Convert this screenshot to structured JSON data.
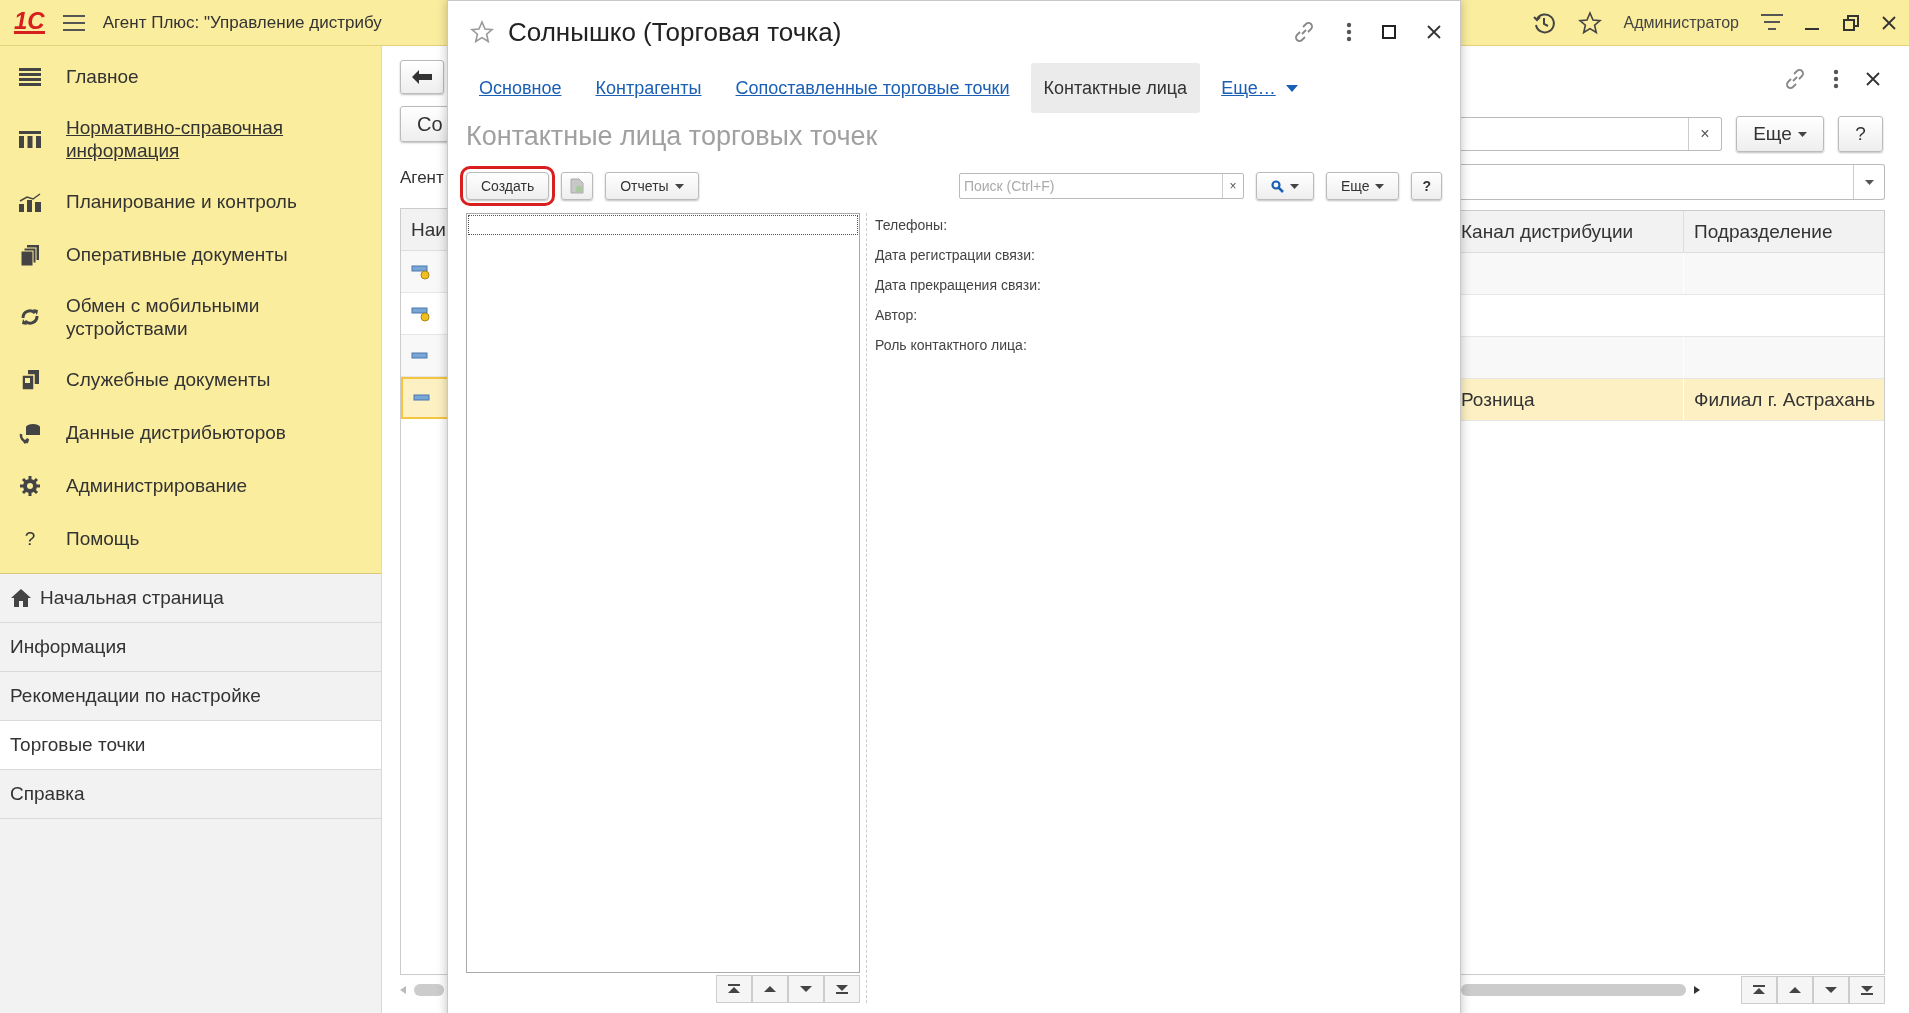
{
  "app_bar": {
    "logo": "1С",
    "title": "Агент Плюс: \"Управление дистрибу",
    "user": "Администратор"
  },
  "sidebar": {
    "sections": [
      {
        "label": "Главное",
        "underlined": false
      },
      {
        "label": "Нормативно-справочная информация",
        "underlined": true
      },
      {
        "label": "Планирование и контроль",
        "underlined": false
      },
      {
        "label": "Оперативные документы",
        "underlined": false
      },
      {
        "label": "Обмен с мобильными устройствами",
        "underlined": false
      },
      {
        "label": "Служебные документы",
        "underlined": false
      },
      {
        "label": "Данные дистрибьюторов",
        "underlined": false
      },
      {
        "label": "Администрирование",
        "underlined": false
      },
      {
        "label": "Помощь",
        "underlined": false,
        "glyph": "?"
      }
    ],
    "pages": [
      {
        "label": "Начальная страница",
        "selected": false,
        "kind": "home"
      },
      {
        "label": "Информация",
        "selected": false,
        "kind": "plain"
      },
      {
        "label": "Рекомендации по настройке",
        "selected": false,
        "kind": "plain"
      },
      {
        "label": "Торговые точки",
        "selected": true,
        "kind": "plain"
      },
      {
        "label": "Справка",
        "selected": false,
        "kind": "plain"
      }
    ]
  },
  "background_list": {
    "create_button": "Со",
    "filter_label": "Агент",
    "more_button": "Еще",
    "help_button": "?",
    "search_clear": "×",
    "columns": [
      "Наи",
      "Канал дистрибуции",
      "Подразделение"
    ],
    "rows": [
      {
        "kind": "flagged",
        "selected": false
      },
      {
        "kind": "flagged",
        "selected": false
      },
      {
        "kind": "plain",
        "selected": false
      },
      {
        "kind": "plain",
        "selected": true,
        "channel": "Розница",
        "division": "Филиал г. Астрахань"
      }
    ]
  },
  "dialog": {
    "title": "Солнышко (Торговая точка)",
    "tabs": [
      {
        "label": "Основное",
        "selected": false
      },
      {
        "label": "Контрагенты",
        "selected": false
      },
      {
        "label": "Сопоставленные торговые точки",
        "selected": false
      },
      {
        "label": "Контактные лица",
        "selected": true
      },
      {
        "label": "Еще…",
        "selected": false,
        "kind": "menu"
      }
    ],
    "heading": "Контактные лица торговых точек",
    "toolbar": {
      "create": {
        "label": "Создать",
        "highlighted": true
      },
      "reports": "Отчеты",
      "search": {
        "placeholder": "Поиск (Ctrl+F)",
        "clear": "×"
      },
      "more": "Еще",
      "help": "?"
    },
    "details": [
      "Телефоны:",
      "Дата регистрации связи:",
      "Дата прекращения связи:",
      "Автор:",
      "Роль контактного лица:"
    ]
  }
}
